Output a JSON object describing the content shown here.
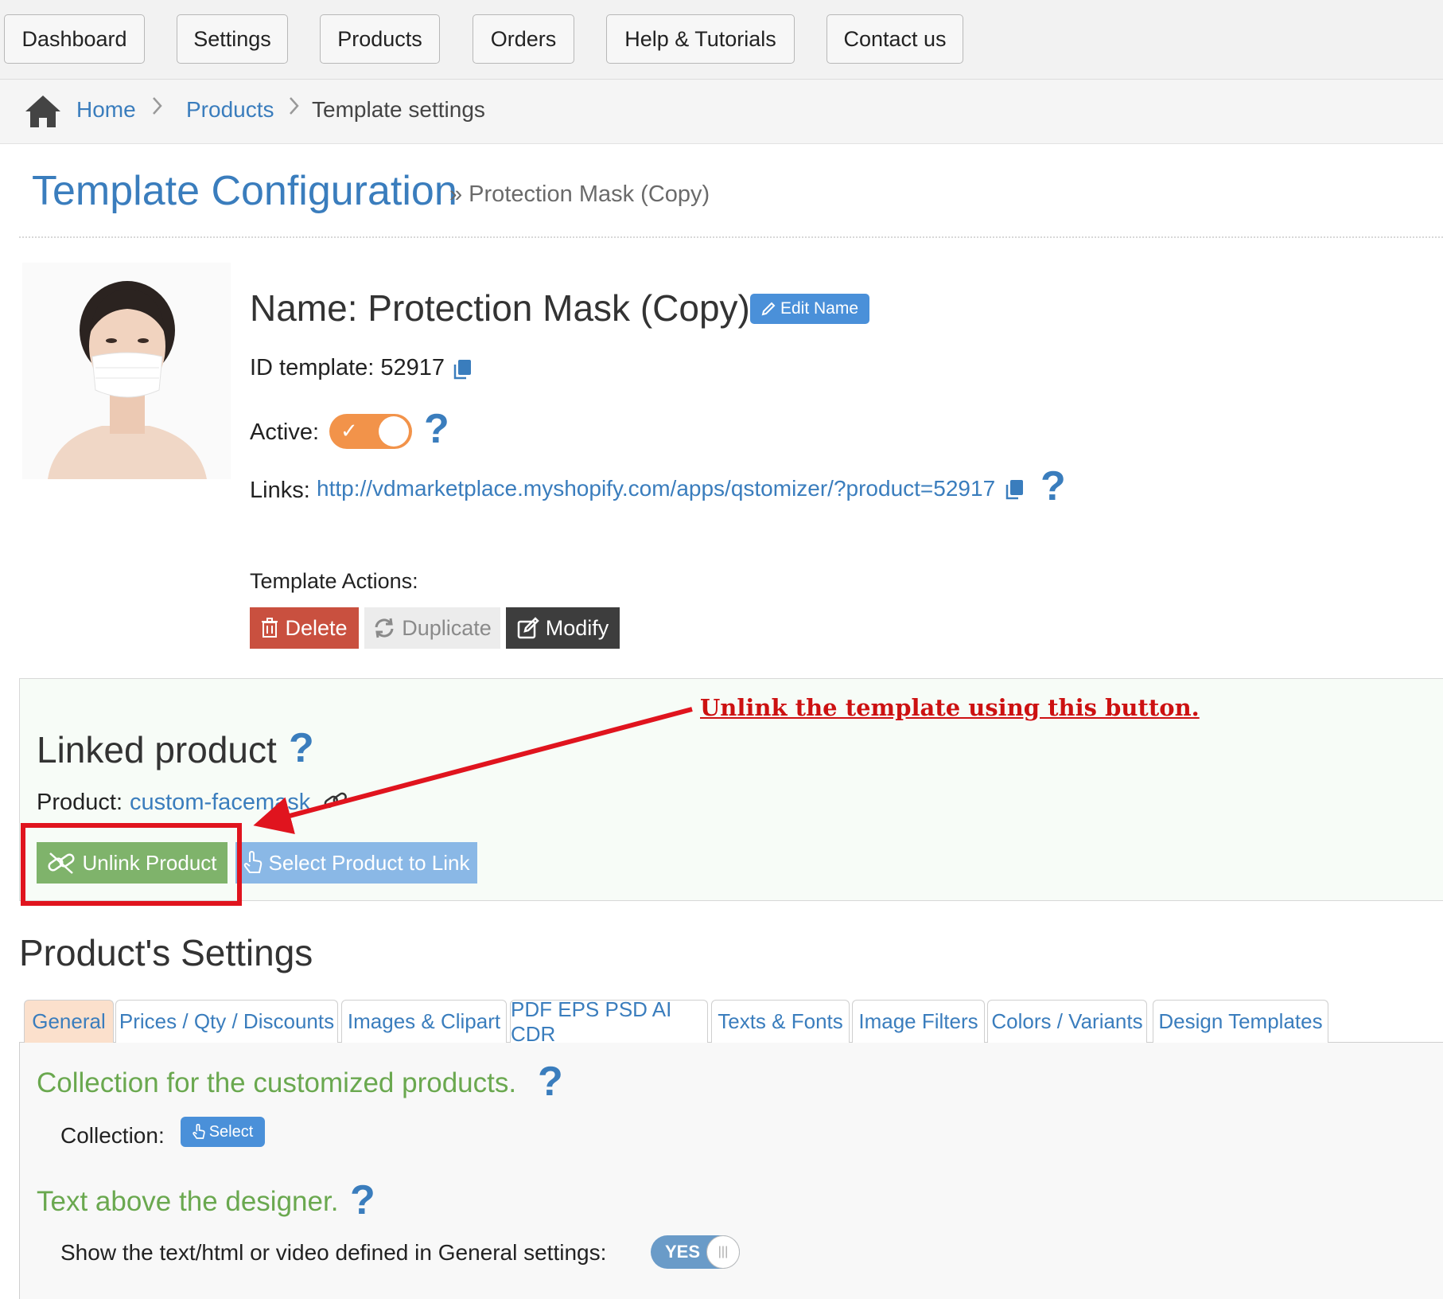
{
  "nav": {
    "items": [
      "Dashboard",
      "Settings",
      "Products",
      "Orders",
      "Help & Tutorials",
      "Contact us"
    ]
  },
  "breadcrumb": {
    "home": "Home",
    "products": "Products",
    "current": "Template settings",
    "separator": ">"
  },
  "header": {
    "title": "Template Configuration",
    "subtitle": "» Protection Mask (Copy)"
  },
  "template": {
    "name_label": "Name: Protection Mask (Copy)",
    "edit_name": "Edit Name",
    "id_label": "ID template: 52917",
    "active_label": "Active:",
    "active": true,
    "links_label": "Links:",
    "link_url": "http://vdmarketplace.myshopify.com/apps/qstomizer/?product=52917",
    "actions_label": "Template Actions:",
    "delete": "Delete",
    "duplicate": "Duplicate",
    "modify": "Modify",
    "help_glyph": "?"
  },
  "linked": {
    "title": "Linked product",
    "product_label": "Product:",
    "product_value": "custom-facemask",
    "unlink": "Unlink Product",
    "select": "Select Product to Link",
    "annotation": "Unlink the template using this button."
  },
  "settings": {
    "title": "Product's Settings",
    "tabs": [
      "General",
      "Prices / Qty / Discounts",
      "Images & Clipart",
      "PDF EPS PSD AI CDR",
      "Texts & Fonts",
      "Image Filters",
      "Colors / Variants",
      "Design Templates"
    ],
    "active_tab": "General",
    "collection_heading": "Collection for the customized products.",
    "collection_label": "Collection:",
    "collection_button": "Select",
    "text_heading": "Text above the designer.",
    "text_label": "Show the text/html or video defined in General settings:",
    "text_toggle": "YES",
    "text_toggle_on": true
  },
  "colors": {
    "link": "#3a7dbd",
    "accent_orange": "#f2934a",
    "delete_red": "#c9503f",
    "unlink_green": "#7fb36b",
    "select_blue": "#8ab8e6",
    "section_green": "#6aa84f",
    "annotation_red": "#cc1111"
  },
  "icons": [
    "home-icon",
    "pencil-icon",
    "copy-icon",
    "trash-icon",
    "refresh-icon",
    "edit-icon",
    "unlink-icon",
    "hand-pointer-icon",
    "link-icon",
    "help-icon"
  ]
}
